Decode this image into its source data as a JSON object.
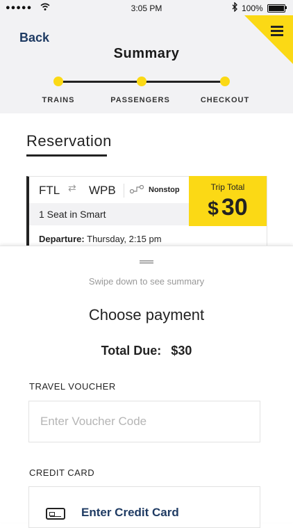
{
  "status_bar": {
    "signal": "●●●●●",
    "time": "3:05 PM",
    "battery": "100%"
  },
  "header": {
    "back_label": "Back",
    "title": "Summary",
    "accent_color": "#fbd915",
    "menu_icon": "hamburger-menu-icon"
  },
  "steps": [
    {
      "label": "TRAINS",
      "active": false
    },
    {
      "label": "PASSENGERS",
      "active": false
    },
    {
      "label": "CHECKOUT",
      "active": true
    }
  ],
  "reservation": {
    "heading": "Reservation",
    "from": "FTL",
    "to": "WPB",
    "route_type": "Nonstop",
    "seat": "1 Seat in Smart",
    "departure_label": "Departure:",
    "departure_value": "Thursday, 2:15 pm",
    "trip_total_label": "Trip Total",
    "trip_total_currency": "$",
    "trip_total_amount": "30"
  },
  "sheet": {
    "swipe_hint": "Swipe down to see summary",
    "choose_title": "Choose payment",
    "total_due_label": "Total Due:",
    "total_due_value": "$30",
    "voucher_label": "TRAVEL VOUCHER",
    "voucher_placeholder": "Enter Voucher Code",
    "voucher_value": "",
    "credit_card_label": "CREDIT CARD",
    "credit_card_button": "Enter Credit Card"
  }
}
